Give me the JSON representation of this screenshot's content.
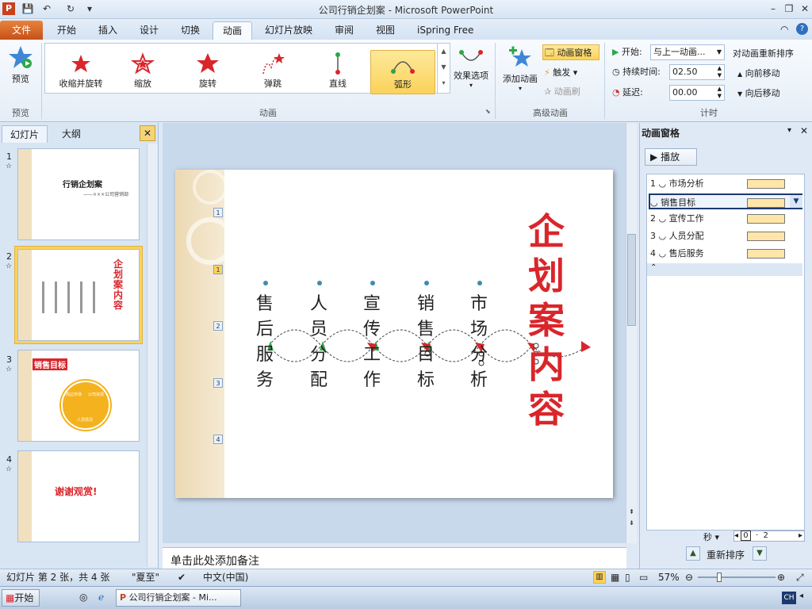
{
  "window": {
    "title": "公司行销企划案 - Microsoft PowerPoint"
  },
  "tabs": {
    "file": "文件",
    "items": [
      "开始",
      "插入",
      "设计",
      "切换",
      "动画",
      "幻灯片放映",
      "审阅",
      "视图",
      "iSpring Free"
    ]
  },
  "ribbon": {
    "preview": "预览",
    "preview_group": "预览",
    "effects": [
      "收缩并旋转",
      "缩放",
      "旋转",
      "弹跳",
      "直线",
      "弧形"
    ],
    "effects_group": "动画",
    "effect_options": "效果选项",
    "add_animation": "添加动画",
    "animation_pane": "动画窗格",
    "trigger": "触发",
    "animation_painter": "动画刷",
    "advanced_group": "高级动画",
    "start_label": "开始:",
    "start_value": "与上一动画...",
    "duration_label": "持续时间:",
    "duration_value": "02.50",
    "delay_label": "延迟:",
    "delay_value": "00.00",
    "reorder_title": "对动画重新排序",
    "move_earlier": "向前移动",
    "move_later": "向后移动",
    "timing_group": "计时"
  },
  "left_pane": {
    "tabs": [
      "幻灯片",
      "大纲"
    ],
    "slides": [
      {
        "num": "1",
        "title": "行销企划案",
        "subtitle": "——×××公司营销部"
      },
      {
        "num": "2",
        "title": "企划案内容"
      },
      {
        "num": "3",
        "title": "销售目标",
        "parts": [
          "周边市场",
          "公司资源",
          "人员情况"
        ]
      },
      {
        "num": "4",
        "title": "谢谢观赏!"
      }
    ]
  },
  "slide": {
    "title": "企划案内容",
    "columns": [
      "售后服务",
      "人员分配",
      "宣传工作",
      "销售目标",
      "市场分析"
    ],
    "markers": [
      "1",
      "1",
      "2",
      "3",
      "4"
    ]
  },
  "notes_placeholder": "单击此处添加备注",
  "anim_pane": {
    "title": "动画窗格",
    "play": "播放",
    "items": [
      {
        "num": "1",
        "name": "市场分析"
      },
      {
        "num": "",
        "name": "销售目标"
      },
      {
        "num": "2",
        "name": "宣传工作"
      },
      {
        "num": "3",
        "name": "人员分配"
      },
      {
        "num": "4",
        "name": "售后服务"
      }
    ],
    "seconds": "秒",
    "timeline": [
      "0",
      "2"
    ],
    "reorder": "重新排序"
  },
  "status": {
    "slide_info": "幻灯片 第 2 张，共 4 张",
    "theme": "\"夏至\"",
    "language": "中文(中国)",
    "zoom": "57%"
  },
  "taskbar": {
    "start": "开始",
    "window": "公司行销企划案 - Mi...",
    "ime": "CH"
  },
  "colors": {
    "accent": "#d9262b",
    "selected": "#fbd25a",
    "ribbon": "#e4edf7"
  }
}
